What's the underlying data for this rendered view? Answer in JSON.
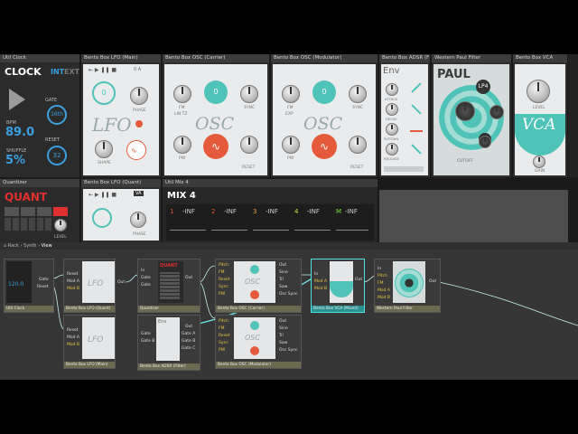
{
  "rack": {
    "util_clock": {
      "header": "Util Clock",
      "title": "CLOCK",
      "mode_int": "INT",
      "mode_ext": "EXT",
      "gate_label": "GATE",
      "gate_value": "16th",
      "bpm_label": "BPM",
      "bpm_value": "89.0",
      "shuffle_label": "SHUFFLE",
      "shuffle_value": "5%",
      "reset_label": "RESET",
      "reset_value": "32"
    },
    "lfo_main": {
      "header": "Bento Box LFO (Main)",
      "title": "LFO",
      "rate_value": "0",
      "labels": [
        "PHASE",
        "SHAPE"
      ]
    },
    "osc_carrier": {
      "header": "Bento Box OSC (Carrier)",
      "title": "OSC",
      "teal_value": "0",
      "labels": [
        "FM",
        "LIN TZ",
        "SYNC",
        "PW",
        "RESET"
      ]
    },
    "osc_modulator": {
      "header": "Bento Box OSC (Modulator)",
      "title": "OSC",
      "teal_value": "0",
      "labels": [
        "FM",
        "EXP",
        "SYNC",
        "PW",
        "RESET"
      ]
    },
    "adsr": {
      "header": "Bento Box ADSR (F",
      "title": "Env",
      "labels": [
        "ATTACK",
        "DECAY",
        "SUSTAIN",
        "RELEASE"
      ]
    },
    "paul_filter": {
      "header": "Western Paul Filter",
      "title": "PAUL",
      "mode": "LP4",
      "labels": [
        "CUTOFF"
      ]
    },
    "vca": {
      "header": "Bento Box VCA",
      "title": "VCA",
      "labels": [
        "LEVEL",
        "GAIN"
      ]
    },
    "quantizer": {
      "header": "Quantizer",
      "title": "QUANT",
      "level_label": "LEVEL"
    },
    "lfo_quant": {
      "header": "Bento Box LFO (Quant)",
      "mode": "VA",
      "labels": [
        "PHASE"
      ]
    },
    "mix4": {
      "header": "Util Mix 4",
      "title": "MIX 4",
      "channels": [
        {
          "num": "1",
          "level": "-INF"
        },
        {
          "num": "2",
          "level": "-INF"
        },
        {
          "num": "3",
          "level": "-INF"
        },
        {
          "num": "4",
          "level": "-INF"
        },
        {
          "num": "M",
          "level": "-INF"
        }
      ]
    }
  },
  "breadcrumb": {
    "items": [
      "Rack",
      "Synth",
      "View"
    ]
  },
  "patch": {
    "nodes": [
      {
        "label": "Util Clock",
        "ports_out": [
          "Gate",
          "Reset"
        ]
      },
      {
        "label": "Bento Box LFO (Quant)",
        "ports_in": [
          "Reset",
          "Mod A",
          "Mod B"
        ],
        "ports_out": [
          "Out"
        ]
      },
      {
        "label": "Quantizer",
        "ports_in": [
          "In",
          "Gate",
          "Gate"
        ],
        "ports_out": [
          "Out"
        ]
      },
      {
        "label": "Bento Box OSC (Carrier)",
        "ports_in": [
          "Pitch",
          "FM",
          "Reset",
          "Sync",
          "PW"
        ],
        "ports_out": [
          "Out",
          "Sine",
          "Tri",
          "Saw",
          "Osc Sync"
        ]
      },
      {
        "label": "Bento Box VCA (Mixed)",
        "ports_in": [
          "In",
          "Mod A",
          "Mod B"
        ],
        "ports_out": [
          "Out"
        ]
      },
      {
        "label": "Western Paul Filter",
        "ports_in": [
          "In",
          "Pitch",
          "FM",
          "Mod A",
          "Mod B"
        ],
        "ports_out": [
          "Out"
        ]
      },
      {
        "label": "Bento Box LFO (Main)",
        "ports_in": [
          "Reset",
          "Mod A",
          "Mod B"
        ],
        "ports_out": []
      },
      {
        "label": "Bento Box ADSR (Filter)",
        "ports_in": [
          "Gate",
          "Gate B"
        ],
        "ports_out": [
          "Out",
          "Gate A",
          "Gate B",
          "Gate C"
        ]
      },
      {
        "label": "Bento Box OSC (Modulator)",
        "ports_in": [
          "Pitch",
          "FM",
          "Reset",
          "Sync",
          "PW"
        ],
        "ports_out": [
          "Out",
          "Sine",
          "Tri",
          "Saw",
          "Osc Sync"
        ]
      }
    ]
  },
  "colors": {
    "teal": "#4fc3b8",
    "orange_red": "#e65a3c",
    "clock_blue": "#3aa0e0",
    "quant_red": "#e03030",
    "cable": "#c8f2f2"
  }
}
